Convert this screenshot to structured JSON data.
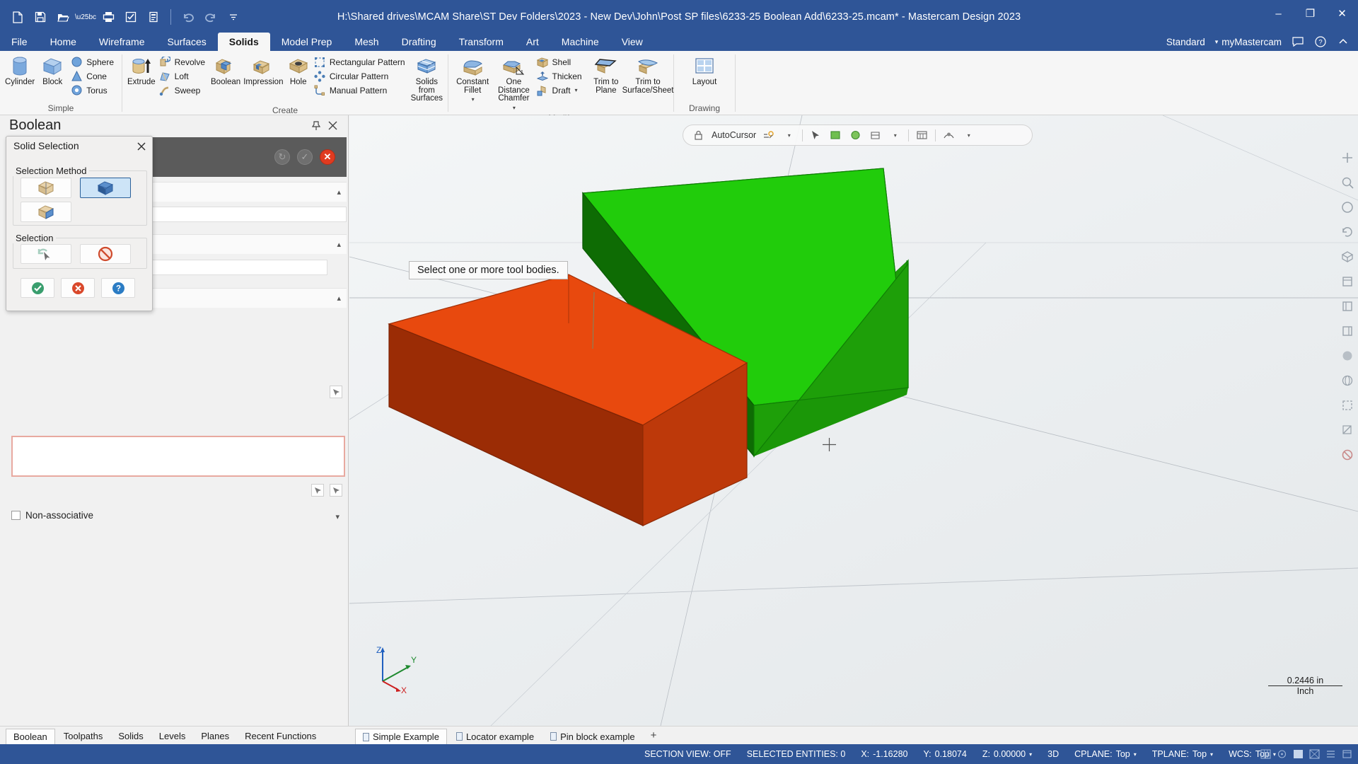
{
  "titlebar": {
    "title": "H:\\Shared drives\\MCAM Share\\ST Dev Folders\\2023 - New Dev\\John\\Post SP files\\6233-25 Boolean Add\\6233-25.mcam* - Mastercam Design 2023",
    "quick_access": [
      {
        "name": "new-file-icon",
        "label": "New"
      },
      {
        "name": "save-icon",
        "label": "Save"
      },
      {
        "name": "open-folder-icon",
        "label": "Open"
      },
      {
        "name": "print-icon",
        "label": "Print"
      },
      {
        "name": "print-preview-icon",
        "label": "Print Preview"
      },
      {
        "name": "zoom-fit-icon",
        "label": "Fit"
      },
      {
        "name": "undo-icon",
        "label": "Undo"
      },
      {
        "name": "redo-icon",
        "label": "Redo"
      },
      {
        "name": "customize-caret-icon",
        "label": "Customize Quick Access Toolbar"
      }
    ],
    "window_controls": [
      {
        "name": "minimize-button",
        "glyph": "–"
      },
      {
        "name": "maximize-button",
        "glyph": "❐"
      },
      {
        "name": "close-button",
        "glyph": "✕"
      }
    ]
  },
  "ribbon": {
    "tabs": [
      {
        "label": "File",
        "active": false
      },
      {
        "label": "Home",
        "active": false
      },
      {
        "label": "Wireframe",
        "active": false
      },
      {
        "label": "Surfaces",
        "active": false
      },
      {
        "label": "Solids",
        "active": true
      },
      {
        "label": "Model Prep",
        "active": false
      },
      {
        "label": "Mesh",
        "active": false
      },
      {
        "label": "Drafting",
        "active": false
      },
      {
        "label": "Transform",
        "active": false
      },
      {
        "label": "Art",
        "active": false
      },
      {
        "label": "Machine",
        "active": false
      },
      {
        "label": "View",
        "active": false
      }
    ],
    "config_name": "Standard",
    "account_label": "myMastercam",
    "groups": [
      {
        "label": "Simple",
        "big": [
          {
            "label": "Cylinder",
            "icon": "cylinder-icon"
          },
          {
            "label": "Block",
            "icon": "block-icon"
          }
        ],
        "small": [
          {
            "label": "Sphere",
            "icon": "sphere-icon"
          },
          {
            "label": "Cone",
            "icon": "cone-icon"
          },
          {
            "label": "Torus",
            "icon": "torus-icon"
          }
        ]
      },
      {
        "label": "Create",
        "big": [
          {
            "label": "Extrude",
            "icon": "extrude-icon"
          },
          {
            "label": "Boolean",
            "icon": "boolean-icon"
          },
          {
            "label": "Impression",
            "icon": "impression-icon"
          },
          {
            "label": "Hole",
            "icon": "hole-icon"
          },
          {
            "label": "Solids from Surfaces",
            "icon": "solids-from-surfaces-icon"
          }
        ],
        "small": [
          {
            "label": "Revolve",
            "icon": "revolve-icon"
          },
          {
            "label": "Loft",
            "icon": "loft-icon"
          },
          {
            "label": "Sweep",
            "icon": "sweep-icon"
          },
          {
            "label": "Rectangular Pattern",
            "icon": "rectangular-pattern-icon"
          },
          {
            "label": "Circular Pattern",
            "icon": "circular-pattern-icon"
          },
          {
            "label": "Manual Pattern",
            "icon": "manual-pattern-icon"
          }
        ]
      },
      {
        "label": "Modify",
        "big": [
          {
            "label": "Constant Fillet",
            "icon": "constant-fillet-icon",
            "dropdown": true
          },
          {
            "label": "One Distance Chamfer",
            "icon": "one-distance-chamfer-icon",
            "dropdown": true
          },
          {
            "label": "Trim to Plane",
            "icon": "trim-to-plane-icon"
          },
          {
            "label": "Trim to Surface/Sheet",
            "icon": "trim-to-surface-icon"
          }
        ],
        "small": [
          {
            "label": "Shell",
            "icon": "shell-icon"
          },
          {
            "label": "Thicken",
            "icon": "thicken-icon"
          },
          {
            "label": "Draft",
            "icon": "draft-icon",
            "dropdown": true
          }
        ]
      },
      {
        "label": "Drawing",
        "big": [
          {
            "label": "Layout",
            "icon": "layout-icon"
          }
        ],
        "small": []
      }
    ]
  },
  "left_panel": {
    "title": "Boolean",
    "pin_icon": "pin-icon",
    "close_icon": "close-icon",
    "header_buttons": [
      {
        "name": "reselect-button",
        "glyph": "↻"
      },
      {
        "name": "apply-button",
        "glyph": "✓"
      },
      {
        "name": "cancel-button",
        "glyph": "✕"
      }
    ],
    "non_associative_label": "Non-associative",
    "tabs": [
      {
        "label": "Boolean",
        "active": true
      },
      {
        "label": "Toolpaths",
        "active": false
      },
      {
        "label": "Solids",
        "active": false
      },
      {
        "label": "Levels",
        "active": false
      },
      {
        "label": "Planes",
        "active": false
      },
      {
        "label": "Recent Functions",
        "active": false
      }
    ]
  },
  "dialog": {
    "title": "Solid Selection",
    "close_icon": "close-icon",
    "selection_method_label": "Selection Method",
    "selection_label": "Selection",
    "method_buttons": [
      {
        "name": "select-solid-face-button",
        "selected": false
      },
      {
        "name": "select-solid-body-button",
        "selected": true
      },
      {
        "name": "select-solid-edge-button",
        "selected": false
      }
    ],
    "selection_buttons": [
      {
        "name": "undo-selection-button",
        "icon": "undo-arrow-cursor-icon"
      },
      {
        "name": "clear-selection-button",
        "icon": "no-entry-icon"
      }
    ],
    "action_buttons": [
      {
        "name": "ok-button",
        "icon": "green-check-icon",
        "color": "#3a9e6e"
      },
      {
        "name": "cancel-button",
        "icon": "red-x-icon",
        "color": "#d9482b"
      },
      {
        "name": "help-button",
        "icon": "blue-question-icon",
        "color": "#2b7cc4"
      }
    ]
  },
  "viewport": {
    "prompt": "Select one or more tool bodies.",
    "toolbar": {
      "autocursor_label": "AutoCursor",
      "items": [
        {
          "name": "autocursor-lock-icon"
        },
        {
          "name": "autocursor-label"
        },
        {
          "name": "autocursor-settings-icon"
        },
        {
          "name": "autocursor-caret-icon"
        },
        {
          "name": "select-arrow-icon"
        },
        {
          "name": "select-window-icon"
        },
        {
          "name": "select-all-icon"
        },
        {
          "name": "select-only-icon"
        },
        {
          "name": "select-caret-icon"
        },
        {
          "name": "analyze-icon"
        },
        {
          "name": "verify-icon"
        }
      ]
    },
    "axes": {
      "x": "X",
      "y": "Y",
      "z": "Z"
    },
    "scale": {
      "value": "0.2446 in",
      "unit": "Inch"
    },
    "bodies": [
      {
        "name": "target-body",
        "color": "#e03c0a",
        "label": "red box"
      },
      {
        "name": "tool-body",
        "color": "#1fc60a",
        "label": "green box"
      }
    ],
    "tabs": [
      {
        "label": "Simple Example",
        "active": true
      },
      {
        "label": "Locator example",
        "active": false
      },
      {
        "label": "Pin block example",
        "active": false
      }
    ],
    "add_tab_glyph": "+"
  },
  "status_bar": {
    "section_view": "SECTION VIEW: OFF",
    "selected_entities": "SELECTED ENTITIES: 0",
    "x_label": "X:",
    "x_value": "-1.16280",
    "y_label": "Y:",
    "y_value": "0.18074",
    "z_label": "Z:",
    "z_value": "0.00000",
    "mode": "3D",
    "cplane_label": "CPLANE:",
    "cplane_value": "Top",
    "tplane_label": "TPLANE:",
    "tplane_value": "Top",
    "wcs_label": "WCS:",
    "wcs_value": "Top",
    "right_icons": [
      {
        "name": "grid-toggle-icon"
      },
      {
        "name": "snap-toggle-icon"
      },
      {
        "name": "shading-toggle-icon"
      },
      {
        "name": "wireframe-toggle-icon"
      },
      {
        "name": "display-options-icon"
      },
      {
        "name": "view-sheet-icon"
      }
    ]
  },
  "colors": {
    "brand_blue": "#2f5597",
    "panel_gray": "#f1f1f1",
    "accent_select": "#cde4f7"
  }
}
